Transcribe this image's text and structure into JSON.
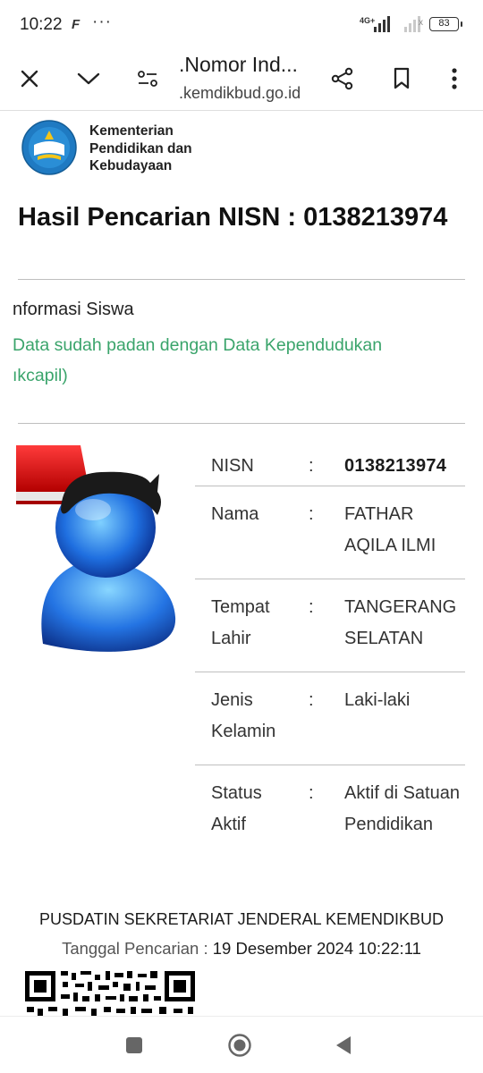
{
  "status_bar": {
    "time": "10:22",
    "notification_icon": "F",
    "more_dots": "···",
    "network": "4G+",
    "battery": "83"
  },
  "browser": {
    "title": ".Nomor Ind...",
    "url": ".kemdikbud.go.id",
    "icons": [
      "close-icon",
      "chevron-down-icon",
      "page-settings-icon",
      "share-icon",
      "bookmark-icon",
      "more-vert-icon"
    ]
  },
  "header": {
    "ministry_line1": "Kementerian",
    "ministry_line2": "Pendidikan dan",
    "ministry_line3": "Kebudayaan",
    "page_title": "Hasil Pencarian NISN : 0138213974"
  },
  "info": {
    "title": "nformasi Siswa",
    "note": "Data sudah padan dengan Data Kependudukan ıkcapil)"
  },
  "student": {
    "rows": [
      {
        "label": "NISN",
        "colon": ":",
        "value": "0138213974"
      },
      {
        "label": "Nama",
        "colon": ":",
        "value": "FATHAR AQILA ILMI"
      },
      {
        "label": "Tempat Lahir",
        "colon": ":",
        "value": "TANGERANG SELATAN"
      },
      {
        "label": "Jenis Kelamin",
        "colon": ":",
        "value": "Laki-laki"
      },
      {
        "label": "Status Aktif",
        "colon": ":",
        "value": "Aktif di Satuan Pendidikan"
      }
    ]
  },
  "footer": {
    "org": "PUSDATIN SEKRETARIAT JENDERAL KEMENDIKBUD",
    "search_date_label": "Tanggal Pencarian :",
    "search_date_value": "19 Desember 2024 10:22:11"
  },
  "nav": {
    "icons": [
      "recent-apps-icon",
      "home-icon",
      "back-icon"
    ]
  },
  "colors": {
    "accent_green": "#3aa46b",
    "divider": "#bfbfbf"
  }
}
